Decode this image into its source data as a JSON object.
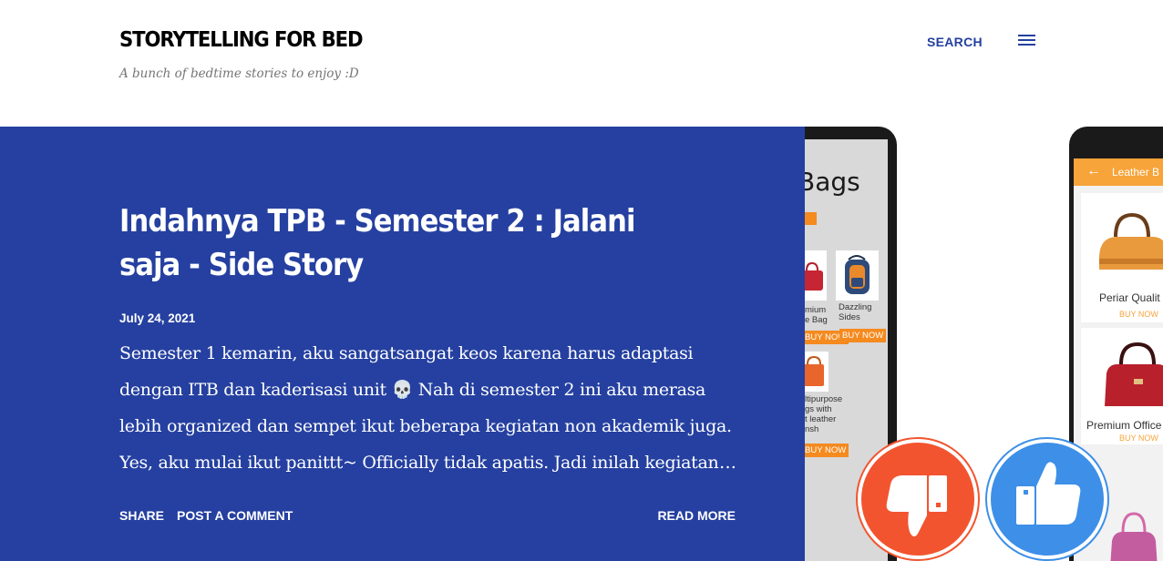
{
  "header": {
    "blog_title": "STORYTELLING FOR BED",
    "blog_description": "A bunch of bedtime stories to enjoy :D",
    "search_label": "SEARCH",
    "menu_icon": "hamburger-menu-icon"
  },
  "post": {
    "title": "Indahnya TPB - Semester 2 : Jalani saja - Side Story",
    "date": "July 24, 2021",
    "snippet_lines": [
      "Semester 1 kemarin, aku sangatsangat keos karena harus adaptasi",
      "dengan ITB dan kaderisasi unit 💀 Nah di semester 2 ini aku merasa",
      "lebih organized dan sempet ikut beberapa kegiatan non akademik juga.",
      "Yes, aku mulai ikut panittt~ Officially tidak apatis. Jadi inilah kegiatan"
    ],
    "ellipsis": "…",
    "share_label": "SHARE",
    "comment_label": "POST A COMMENT",
    "read_more_label": "READ MORE"
  },
  "hero": {
    "left_screen": {
      "heading": "Bags",
      "items": [
        {
          "text": "mium\ne Bag",
          "buy": "BUY NOW"
        },
        {
          "text": "Dazzling\nSides",
          "buy": "BUY NOW"
        },
        {
          "text": "ltipurpose\ngs with\nt leather\nnsh",
          "buy": "BUY NOW"
        }
      ]
    },
    "right_screen": {
      "appbar_title": "Leather B",
      "items": [
        {
          "name": "Periar Qualit",
          "buy": "BUY NOW"
        },
        {
          "name": "Premium Office",
          "buy": "BUY NOW"
        }
      ]
    },
    "thumbs_down_icon": "thumbs-down-icon",
    "thumbs_up_icon": "thumbs-up-icon"
  },
  "colors": {
    "accent": "#24409f",
    "panel": "#2540a0",
    "orange": "#f58a1f",
    "thumbs_down": "#f2542f",
    "thumbs_up": "#3d8fe8"
  }
}
